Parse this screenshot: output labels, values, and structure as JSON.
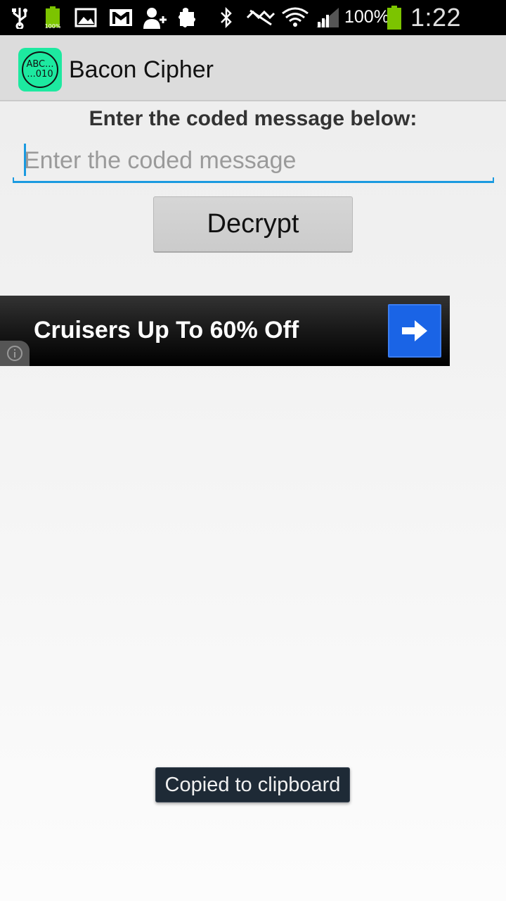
{
  "status_bar": {
    "battery_percent": "100%",
    "time": "1:22 PM",
    "icons": [
      "usb-icon",
      "battery-app-icon",
      "gallery-icon",
      "gmail-icon",
      "add-contact-icon",
      "puzzle-icon",
      "bluetooth-icon",
      "no-signal-icon",
      "wifi-icon",
      "signal-icon",
      "battery-icon"
    ],
    "small_battery_label": "100%"
  },
  "app_bar": {
    "title": "Bacon Cipher",
    "icon_text_top": "ABC...",
    "icon_text_bottom": "...010"
  },
  "main": {
    "prompt": "Enter the coded message below:",
    "input_placeholder": "Enter the coded message",
    "input_value": "",
    "decrypt_label": "Decrypt"
  },
  "ad": {
    "text": "Cruisers Up To 60% Off"
  },
  "toast": {
    "message": "Copied to clipboard"
  },
  "colors": {
    "accent": "#1a9ae0",
    "app_icon_bg": "#1de9a0",
    "ad_button": "#1a64e6",
    "battery_green": "#7cc400"
  }
}
